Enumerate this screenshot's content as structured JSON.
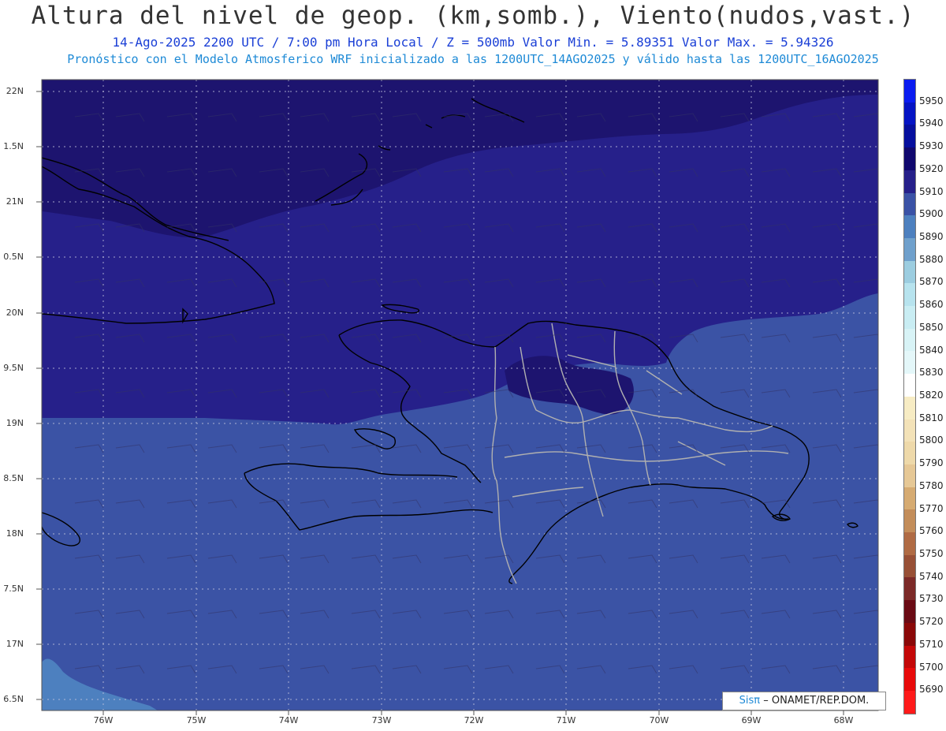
{
  "title": "Altura del nivel de geop. (km,somb.), Viento(nudos,vast.)",
  "subtitle_line1": "14-Ago-2025  2200 UTC / 7:00 pm Hora Local / Z = 500mb    Valor Min. = 5.89351  Valor Max. = 5.94326",
  "subtitle_line2": "Pronóstico con el Modelo Atmosferico WRF inicializado a las 1200UTC_14AGO2025 y válido hasta las  1200UTC_16AGO2025",
  "lat_labels": [
    "22N",
    "1.5N",
    "21N",
    "0.5N",
    "20N",
    "9.5N",
    "19N",
    "8.5N",
    "18N",
    "7.5N",
    "17N",
    "6.5N"
  ],
  "lon_labels": [
    "76W",
    "75W",
    "74W",
    "73W",
    "72W",
    "71W",
    "70W",
    "69W",
    "68W"
  ],
  "colorbar": {
    "values": [
      "5950",
      "5940",
      "5930",
      "5920",
      "5910",
      "5900",
      "5890",
      "5880",
      "5870",
      "5860",
      "5850",
      "5840",
      "5830",
      "5820",
      "5810",
      "5800",
      "5790",
      "5780",
      "5770",
      "5760",
      "5750",
      "5740",
      "5730",
      "5720",
      "5710",
      "5700",
      "5690"
    ],
    "colors": [
      "#0a1cf0",
      "#0514c4",
      "#060f9e",
      "#10086e",
      "#26208a",
      "#3a52a6",
      "#4d80bf",
      "#6fa0cc",
      "#9ccde0",
      "#b7e3ee",
      "#c9edf3",
      "#d8f3f6",
      "#e4f7f9",
      "#ffffff",
      "#f7ecc4",
      "#f3e2b8",
      "#eed9aa",
      "#e6c896",
      "#d6ab72",
      "#c38d5a",
      "#b06b44",
      "#985036",
      "#7c2a28",
      "#6a0a14",
      "#8a0808",
      "#c40808",
      "#e80a0a",
      "#ff1a1a"
    ]
  },
  "fields": {
    "color_high": "#251f7e",
    "color_mid": "#26208a",
    "color_low": "#3b53a5",
    "color_light": "#4d80bf"
  },
  "credit": {
    "brand": "Sisπ",
    "text": "– ONAMET/REP.DOM."
  }
}
